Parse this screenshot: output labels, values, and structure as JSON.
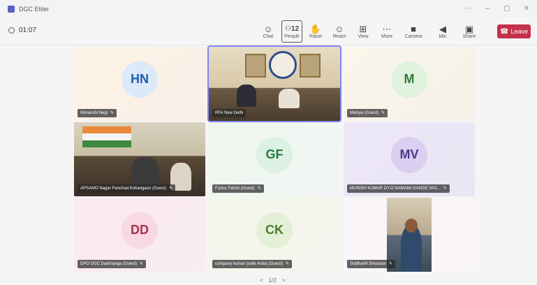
{
  "window": {
    "title": "DGC Etiler"
  },
  "toolbar": {
    "timer": "01:07",
    "tools": [
      {
        "name": "chat",
        "label": "Chat",
        "icon": "chat-icon",
        "glyph": "☺"
      },
      {
        "name": "people",
        "label": "People",
        "icon": "people-icon",
        "glyph": "⚇12",
        "count": "12"
      },
      {
        "name": "raise",
        "label": "Raise",
        "icon": "hand-icon",
        "glyph": "✋"
      },
      {
        "name": "react",
        "label": "React",
        "icon": "smile-icon",
        "glyph": "☺"
      },
      {
        "name": "view",
        "label": "View",
        "icon": "grid-icon",
        "glyph": "⊞"
      },
      {
        "name": "more",
        "label": "More",
        "icon": "more-icon",
        "glyph": "⋯"
      },
      {
        "name": "camera",
        "label": "Camera",
        "icon": "camera-icon",
        "glyph": "■"
      },
      {
        "name": "mic",
        "label": "Mic",
        "icon": "mic-icon",
        "glyph": "◀"
      },
      {
        "name": "share",
        "label": "Share",
        "icon": "share-icon",
        "glyph": "▣"
      }
    ],
    "leave_label": "Leave"
  },
  "participants": [
    {
      "initials": "HN",
      "name": "Himanshi Negi"
    },
    {
      "initials": "",
      "name": "RFA New Delhi"
    },
    {
      "initials": "M",
      "name": "Mahiya (Guest)"
    },
    {
      "initials": "",
      "name": "APSAMO Nagar Panchad Kohangaon (Guest)"
    },
    {
      "initials": "GF",
      "name": "Fazlur Fahmi (Guest)"
    },
    {
      "initials": "MV",
      "name": "MUNISH KUMAR DY.O NAMAMI GANGE VAS..."
    },
    {
      "initials": "DD",
      "name": "DPO DGC Dadrnanga (Guest)"
    },
    {
      "initials": "CK",
      "name": "company kumar (solle India) (Guest)"
    },
    {
      "initials": "",
      "name": "Siddharth Srivastav"
    }
  ],
  "pager": {
    "prev": "<",
    "label": "1/2",
    "next": ">"
  },
  "colors": {
    "leave": "#c4314b",
    "active_speaker": "#7f85f5"
  }
}
